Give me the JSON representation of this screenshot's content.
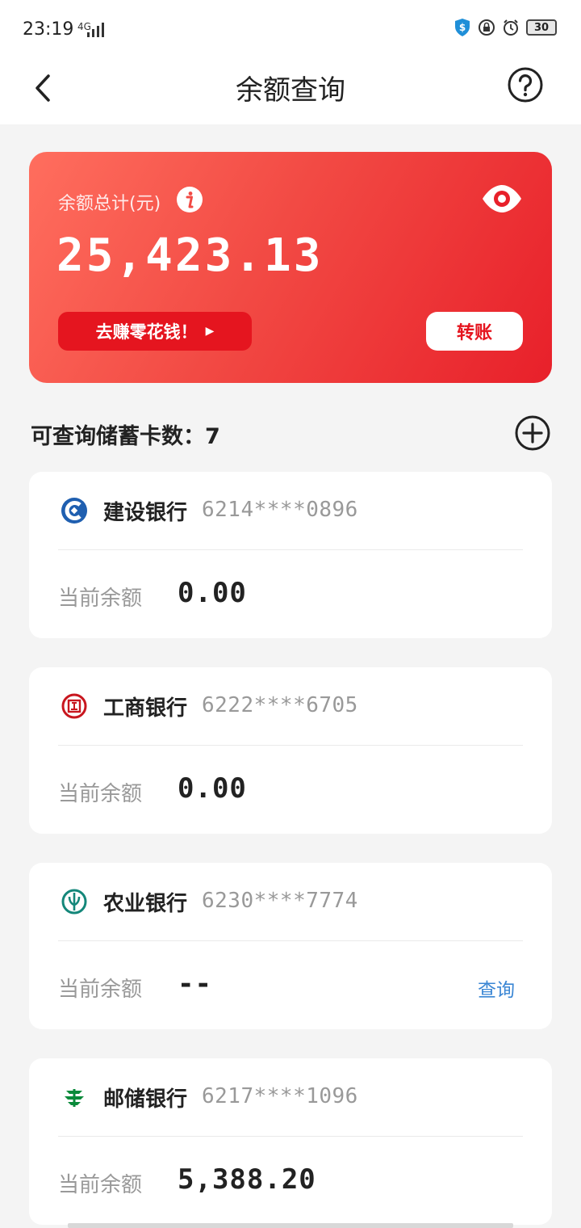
{
  "status": {
    "time": "23:19",
    "network": "4G",
    "battery": "30"
  },
  "nav": {
    "title": "余额查询"
  },
  "balance": {
    "label": "余额总计(元)",
    "amount": "25,423.13",
    "earn_label": "去赚零花钱！",
    "earn_arrow": "▶",
    "transfer_label": "转账"
  },
  "section": {
    "title": "可查询储蓄卡数：7"
  },
  "cards": [
    {
      "bank": "建设银行",
      "number": "6214****0896",
      "balance_label": "当前余额",
      "balance": "0.00",
      "query": ""
    },
    {
      "bank": "工商银行",
      "number": "6222****6705",
      "balance_label": "当前余额",
      "balance": "0.00",
      "query": ""
    },
    {
      "bank": "农业银行",
      "number": "6230****7774",
      "balance_label": "当前余额",
      "balance": "--",
      "query": "查询"
    },
    {
      "bank": "邮储银行",
      "number": "6217****1096",
      "balance_label": "当前余额",
      "balance": "5,388.20",
      "query": ""
    }
  ],
  "colors": {
    "accent": "#e5151f",
    "link": "#3a86d4",
    "ccb": "#1f5fb0",
    "icbc": "#c8161e",
    "abc": "#14877a",
    "psbc": "#0a8a3a"
  },
  "icons": [
    "back-icon",
    "help-icon",
    "info-icon",
    "eye-icon",
    "add-icon",
    "ccb-logo-icon",
    "icbc-logo-icon",
    "abc-logo-icon",
    "psbc-logo-icon"
  ]
}
